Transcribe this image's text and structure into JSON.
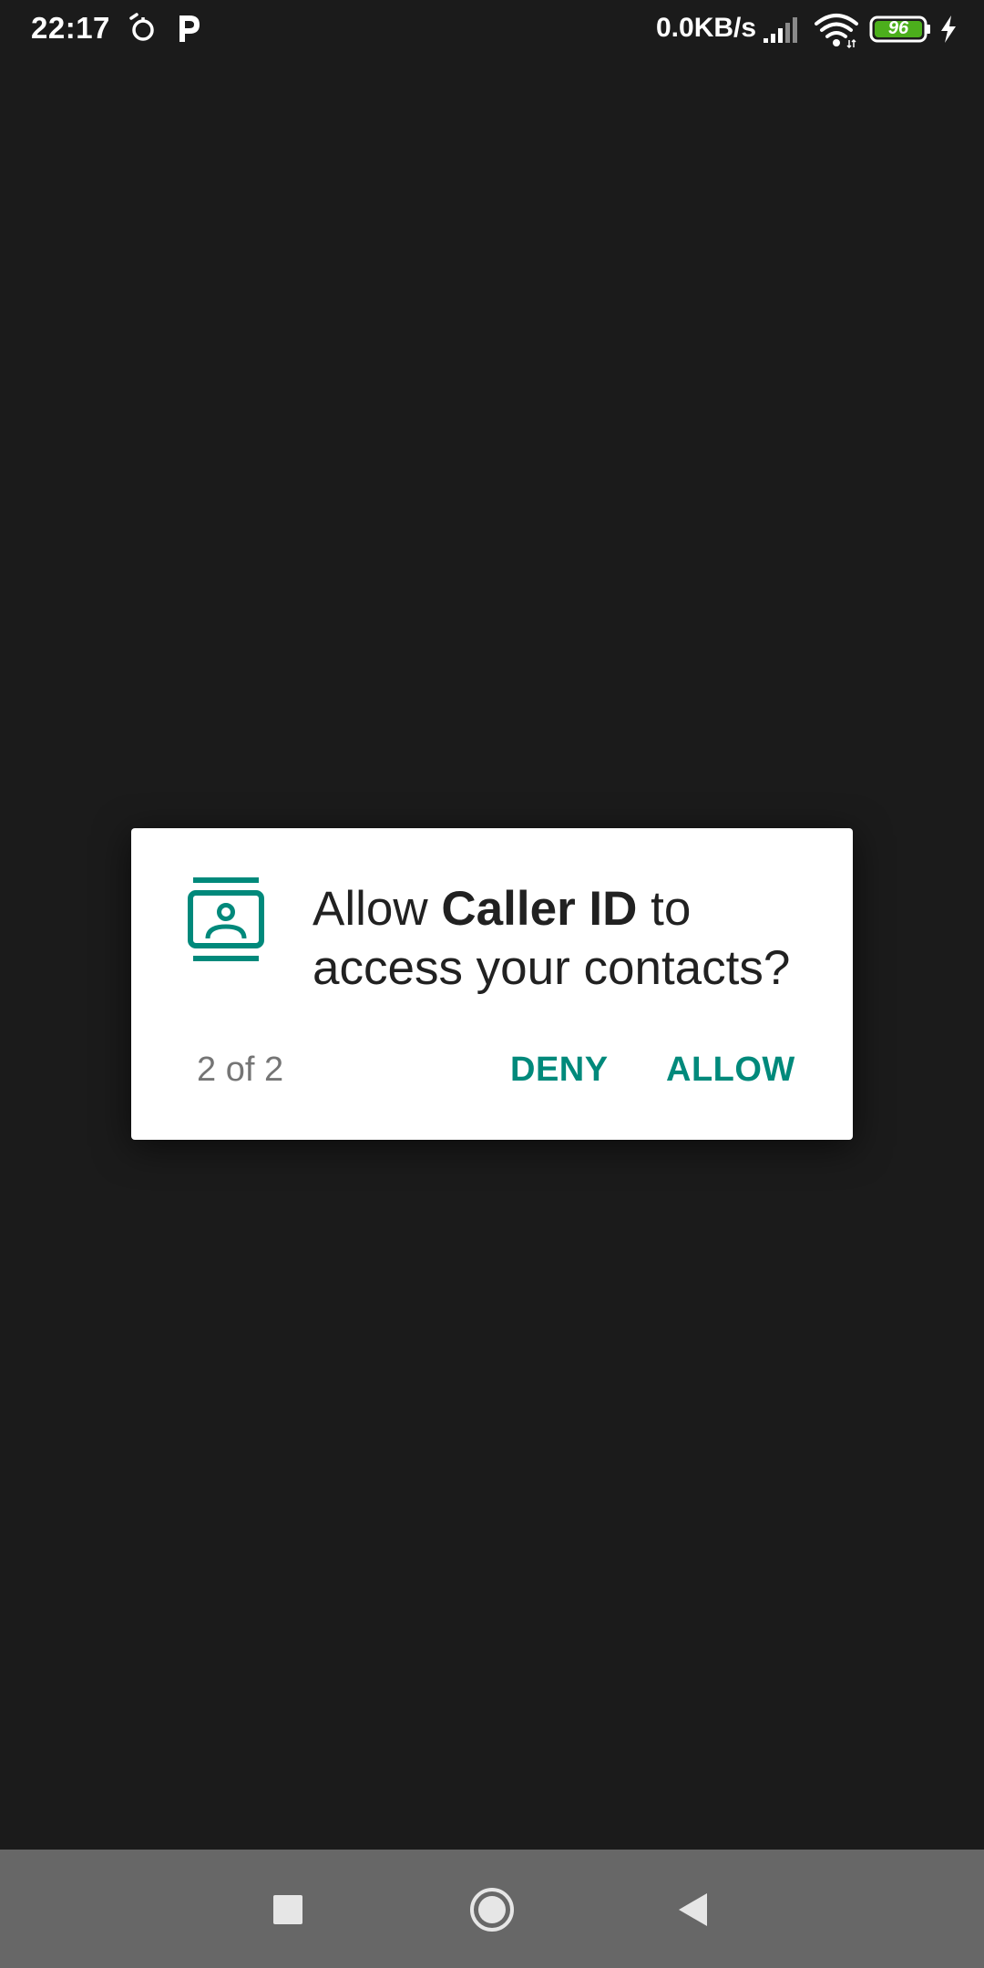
{
  "status_bar": {
    "time": "22:17",
    "network_speed": "0.0KB/s",
    "battery_level": "96",
    "icons": [
      "alarm-icon",
      "parking-app-icon",
      "signal-icon",
      "wifi-icon",
      "battery-icon",
      "charging-icon"
    ]
  },
  "dialog": {
    "message_prefix": "Allow ",
    "app_name": "Caller ID",
    "message_suffix": " to access your contacts?",
    "counter": "2 of 2",
    "deny_label": "DENY",
    "allow_label": "ALLOW",
    "icon": "contacts-icon",
    "accent_color": "#00897b"
  },
  "nav_bar": {
    "icons": [
      "recents-icon",
      "home-icon",
      "back-icon"
    ]
  }
}
